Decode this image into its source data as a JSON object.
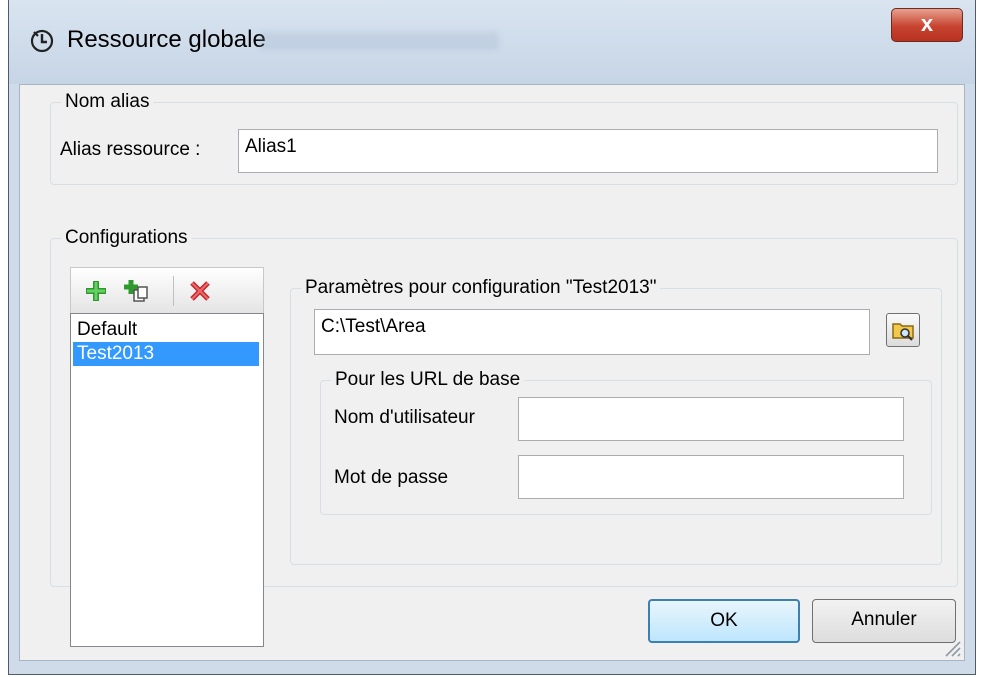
{
  "window": {
    "title": "Ressource globale",
    "icon": "global-resource-icon",
    "close_label": "x"
  },
  "alias_group": {
    "legend": "Nom alias",
    "label": "Alias ressource :",
    "value": "Alias1"
  },
  "config_group": {
    "legend": "Configurations",
    "toolbar": {
      "add_icon": "add-plus-icon",
      "copy_icon": "add-copy-icon",
      "delete_icon": "delete-x-icon"
    },
    "items": [
      {
        "label": "Default",
        "selected": false
      },
      {
        "label": "Test2013",
        "selected": true
      }
    ]
  },
  "params_group": {
    "legend": "Paramètres pour configuration \"Test2013\"",
    "path_value": "C:\\Test\\Area",
    "browse_icon": "folder-browse-icon"
  },
  "url_group": {
    "legend": "Pour les URL de base",
    "username_label": "Nom d'utilisateur",
    "username_value": "",
    "password_label": "Mot de passe",
    "password_value": ""
  },
  "buttons": {
    "ok": "OK",
    "cancel": "Annuler"
  },
  "colors": {
    "selection": "#3399ff",
    "ok_border": "#3c7fb1",
    "close_button": "#c7432f"
  }
}
